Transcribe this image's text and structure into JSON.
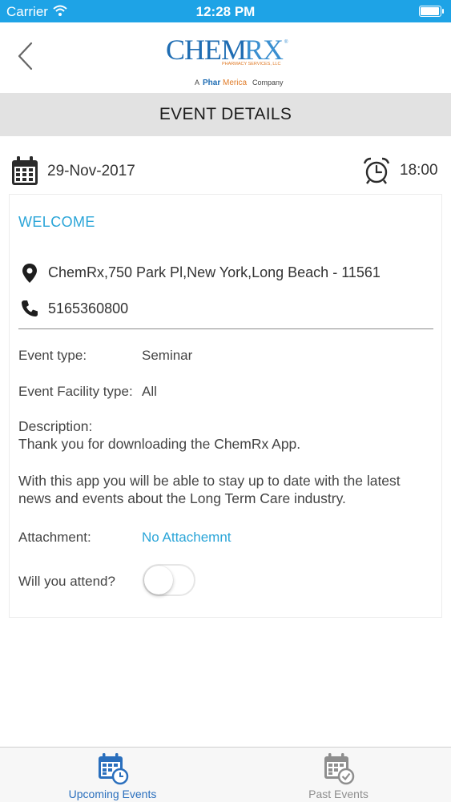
{
  "status_bar": {
    "carrier": "Carrier",
    "time": "12:28 PM",
    "battery_level_pct": 100
  },
  "header": {
    "logo": {
      "brand": "CHEMRX",
      "tagline": "PHARMACY SERVICES, LLC",
      "company_prefix": "A",
      "company_name": "PharMerica",
      "company_suffix": "Company"
    }
  },
  "page": {
    "title": "EVENT DETAILS"
  },
  "event": {
    "date": "29-Nov-2017",
    "time": "18:00",
    "name": "WELCOME",
    "address": "ChemRx,750 Park Pl,New York,Long Beach - 11561",
    "phone": "5165360800",
    "type_label": "Event type:",
    "type_value": "Seminar",
    "facility_label": "Event Facility type:",
    "facility_value": "All",
    "description_label": "Description:",
    "description_line1": "Thank you for downloading the ChemRx App.",
    "description_line2": "With this app you will be able to stay up to date with the latest news and events about the Long Term Care industry.",
    "attachment_label": "Attachment:",
    "attachment_value": "No Attachemnt",
    "attend_label": "Will you attend?",
    "attend_on": false
  },
  "tabs": [
    {
      "label": "Upcoming Events",
      "icon": "calendar-clock-icon",
      "active": true
    },
    {
      "label": "Past Events",
      "icon": "calendar-check-icon",
      "active": false
    }
  ],
  "colors": {
    "status_bar": "#1ea3e6",
    "accent": "#2aa5d8",
    "tab_active": "#2a6fbd",
    "tab_inactive": "#8e8e8e"
  }
}
